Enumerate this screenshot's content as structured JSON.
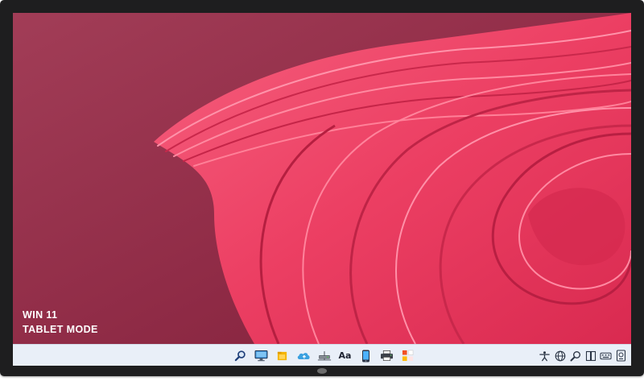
{
  "overlay": {
    "line1": "WIN 11",
    "line2": "TABLET MODE"
  },
  "colors": {
    "bezel": "#1e1e1f",
    "wallpaper_background": "#9a2f4a",
    "wallpaper_ribbon": "#f2466a",
    "taskbar": "#e9eff8",
    "overlay_text": "#ffffff"
  },
  "taskbar": {
    "center_apps": [
      {
        "icon": "search-icon"
      },
      {
        "icon": "desktop-icon"
      },
      {
        "icon": "file-explorer-icon"
      },
      {
        "icon": "onedrive-icon"
      },
      {
        "icon": "network-drive-icon"
      },
      {
        "icon": "font-icon",
        "glyph": "Aa"
      },
      {
        "icon": "phone-icon"
      },
      {
        "icon": "printer-icon"
      },
      {
        "icon": "apps-icon"
      }
    ],
    "tray": [
      {
        "icon": "accessibility-icon"
      },
      {
        "icon": "globe-icon"
      },
      {
        "icon": "magnifier-icon"
      },
      {
        "icon": "book-icon"
      },
      {
        "icon": "keyboard-icon"
      },
      {
        "icon": "device-icon"
      }
    ]
  }
}
